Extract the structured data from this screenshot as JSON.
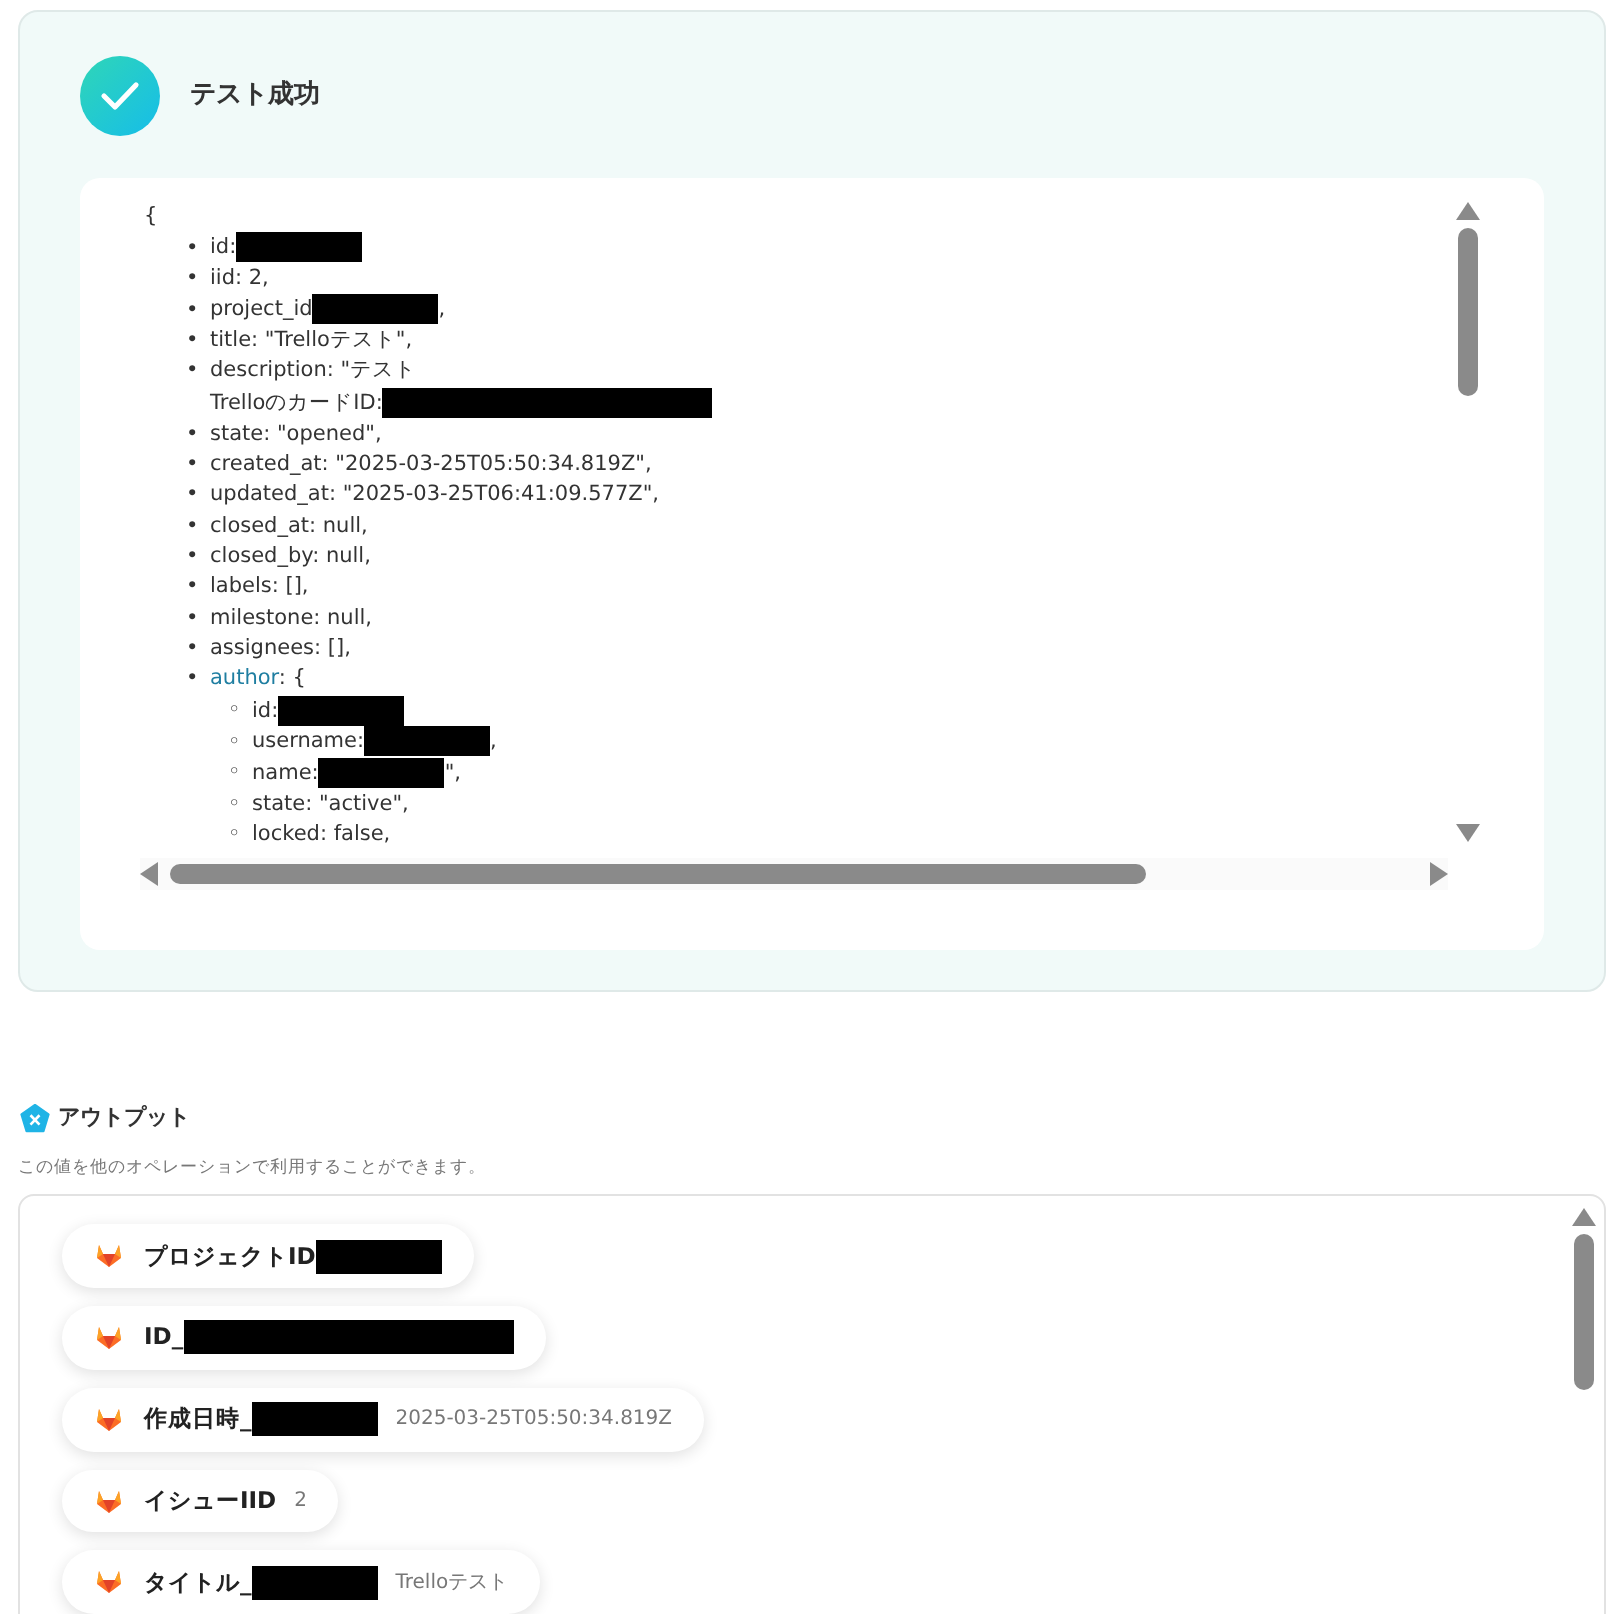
{
  "test_result": {
    "title": "テスト成功",
    "json_open": "{",
    "lines": [
      {
        "marker": "•",
        "segments": [
          {
            "text": "id:"
          },
          {
            "kind": "redaction"
          }
        ]
      },
      {
        "marker": "•",
        "segments": [
          {
            "text": "iid: 2,"
          }
        ]
      },
      {
        "marker": "•",
        "segments": [
          {
            "text": "project_id"
          },
          {
            "kind": "redaction"
          },
          {
            "text": ","
          }
        ]
      },
      {
        "marker": "•",
        "segments": [
          {
            "text": "title: \"Trelloテスト\","
          }
        ]
      },
      {
        "marker": "•",
        "segments": [
          {
            "text": "description: \"テスト"
          }
        ]
      },
      {
        "segments": [
          {
            "text": "TrelloのカードID:"
          },
          {
            "kind": "long_redaction"
          }
        ]
      },
      {
        "marker": "•",
        "segments": [
          {
            "text": "state: \"opened\","
          }
        ]
      },
      {
        "marker": "•",
        "segments": [
          {
            "text": "created_at: \"2025-03-25T05:50:34.819Z\","
          }
        ]
      },
      {
        "marker": "•",
        "segments": [
          {
            "text": "updated_at: \"2025-03-25T06:41:09.577Z\","
          }
        ]
      },
      {
        "marker": "•",
        "segments": [
          {
            "text": "closed_at: null,"
          }
        ]
      },
      {
        "marker": "•",
        "segments": [
          {
            "text": "closed_by: null,"
          }
        ]
      },
      {
        "marker": "•",
        "segments": [
          {
            "text": "labels: [],"
          }
        ]
      },
      {
        "marker": "•",
        "segments": [
          {
            "text": "milestone: null,"
          }
        ]
      },
      {
        "marker": "•",
        "segments": [
          {
            "text": "assignees: [],"
          }
        ]
      },
      {
        "marker": "•",
        "segments": [
          {
            "text": "author",
            "kind": "key"
          },
          {
            "text": ": {"
          }
        ],
        "children": [
          {
            "marker": "◦",
            "segments": [
              {
                "text": "id:"
              },
              {
                "kind": "redaction"
              }
            ]
          },
          {
            "marker": "◦",
            "segments": [
              {
                "text": "username:"
              },
              {
                "kind": "redaction"
              },
              {
                "text": ","
              }
            ]
          },
          {
            "marker": "◦",
            "segments": [
              {
                "text": "name:"
              },
              {
                "kind": "redaction"
              },
              {
                "text": "\","
              }
            ]
          },
          {
            "marker": "◦",
            "segments": [
              {
                "text": "state: \"active\","
              }
            ]
          },
          {
            "marker": "◦",
            "segments": [
              {
                "text": "locked: false,"
              }
            ]
          }
        ]
      }
    ]
  },
  "output": {
    "title": "アウトプット",
    "subtitle": "この値を他のオペレーションで利用することができます。",
    "items": [
      {
        "segments": [
          {
            "text": "プロジェクトID"
          },
          {
            "kind": "redaction"
          }
        ]
      },
      {
        "segments": [
          {
            "text": "ID_"
          },
          {
            "kind": "long_redaction"
          }
        ]
      },
      {
        "segments": [
          {
            "text": "作成日時_"
          },
          {
            "kind": "redaction"
          }
        ],
        "value": "2025-03-25T05:50:34.819Z"
      },
      {
        "segments": [
          {
            "text": "イシューIID"
          }
        ],
        "value": "2"
      },
      {
        "segments": [
          {
            "text": "タイトル_"
          },
          {
            "kind": "redaction"
          }
        ],
        "value": "Trelloテスト"
      }
    ]
  }
}
